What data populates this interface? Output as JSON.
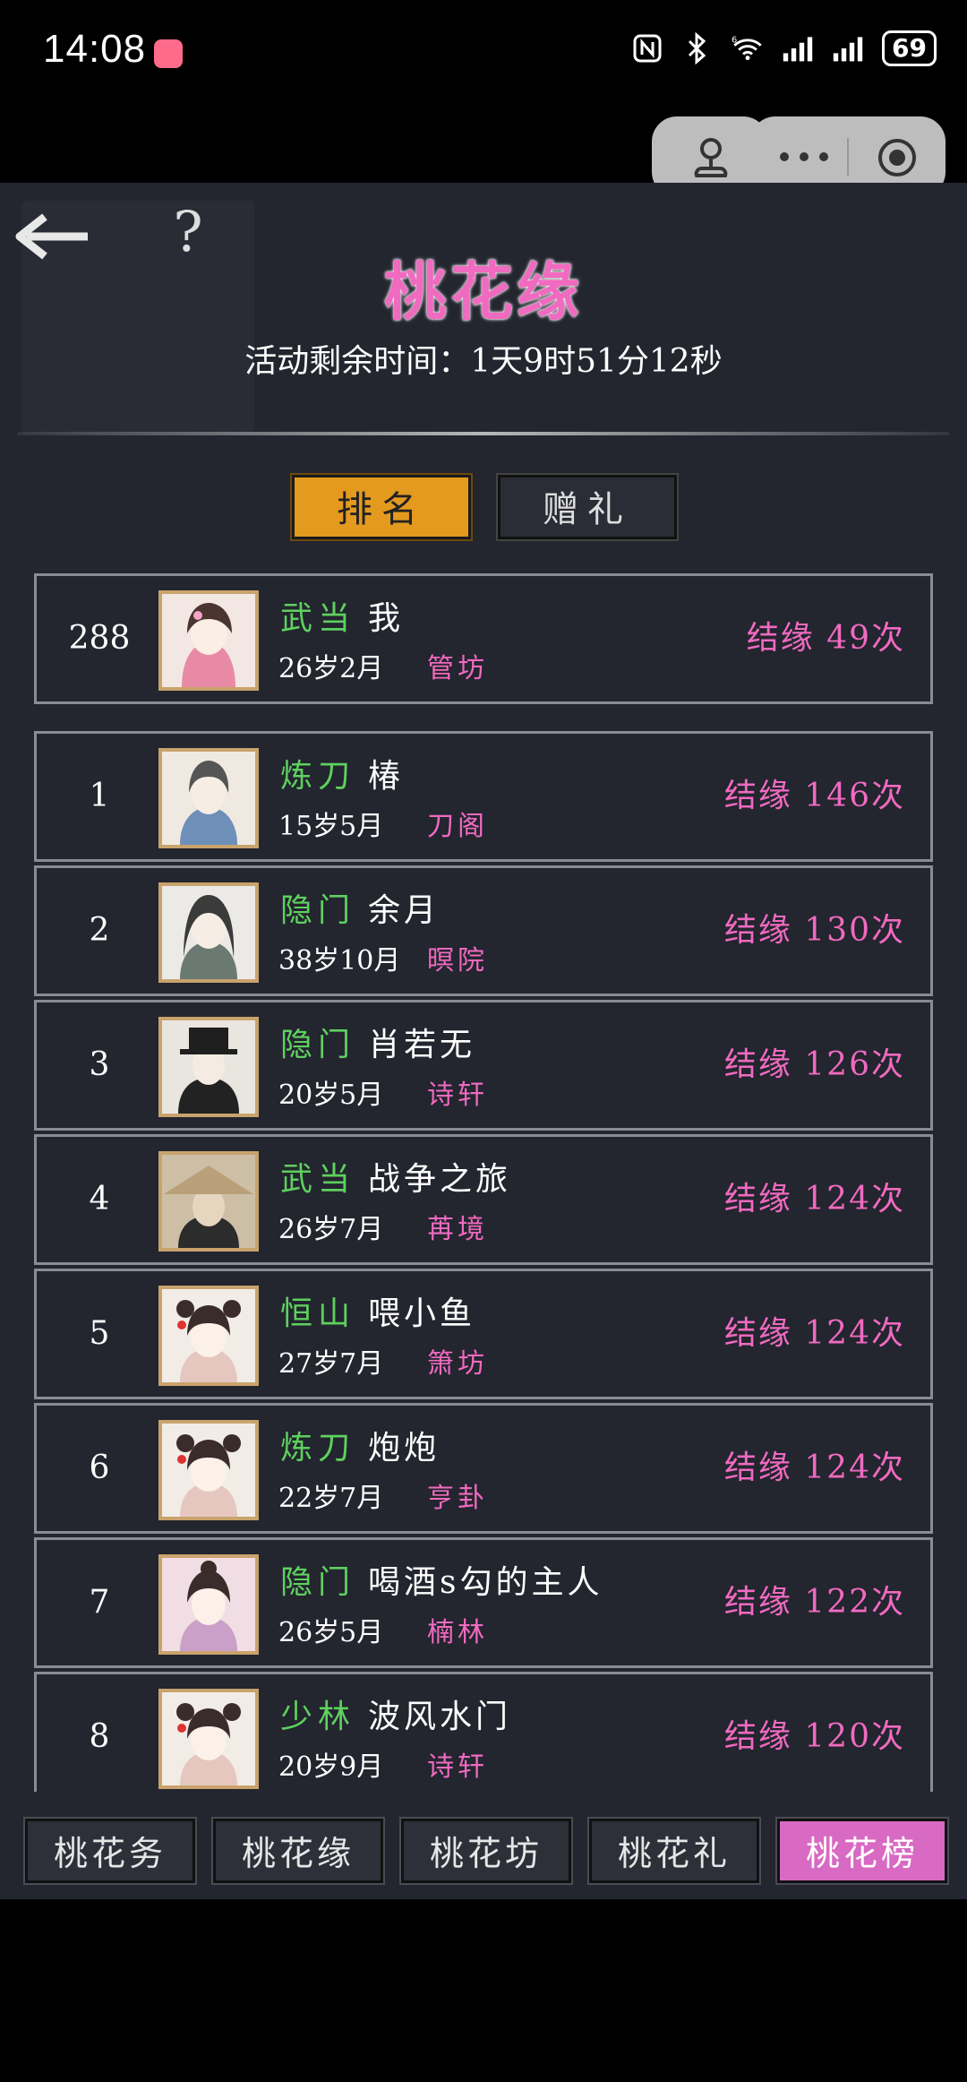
{
  "status_bar": {
    "time": "14:08",
    "battery": "69",
    "icons": [
      "nfc-icon",
      "bluetooth-icon",
      "wifi-icon",
      "signal-icon",
      "signal-icon"
    ],
    "wifi_label": "6"
  },
  "capsule": {
    "left_icon": "mini-program-icon",
    "more_icon": "more-dots-icon",
    "close_icon": "target-icon"
  },
  "header": {
    "title": "桃花缘",
    "countdown": "活动剩余时间：1天9时51分12秒",
    "back_icon": "back-arrow-icon",
    "help_label": "?"
  },
  "tabs": [
    {
      "label": "排名",
      "active": true
    },
    {
      "label": "赠礼",
      "active": false
    }
  ],
  "self_row": {
    "rank": "288",
    "sect": "武当",
    "name": "我",
    "age": "26岁2月",
    "house": "管坊",
    "bonds": "结缘 49次"
  },
  "ranking": [
    {
      "rank": "1",
      "sect": "炼刀",
      "name": "椿",
      "age": "15岁5月",
      "house": "刀阁",
      "bonds": "结缘 146次"
    },
    {
      "rank": "2",
      "sect": "隐门",
      "name": "余月",
      "age": "38岁10月",
      "house": "暝院",
      "bonds": "结缘 130次"
    },
    {
      "rank": "3",
      "sect": "隐门",
      "name": "肖若无",
      "age": "20岁5月",
      "house": "诗轩",
      "bonds": "结缘 126次"
    },
    {
      "rank": "4",
      "sect": "武当",
      "name": "战争之旅",
      "age": "26岁7月",
      "house": "苒境",
      "bonds": "结缘 124次"
    },
    {
      "rank": "5",
      "sect": "恒山",
      "name": "喂小鱼",
      "age": "27岁7月",
      "house": "箫坊",
      "bonds": "结缘 124次"
    },
    {
      "rank": "6",
      "sect": "炼刀",
      "name": "炮炮",
      "age": "22岁7月",
      "house": "亨卦",
      "bonds": "结缘 124次"
    },
    {
      "rank": "7",
      "sect": "隐门",
      "name": "喝酒s勾的主人",
      "age": "26岁5月",
      "house": "楠林",
      "bonds": "结缘 122次"
    },
    {
      "rank": "8",
      "sect": "少林",
      "name": "波风水门",
      "age": "20岁9月",
      "house": "诗轩",
      "bonds": "结缘 120次"
    }
  ],
  "bottom_nav": [
    {
      "label": "桃花务",
      "active": false
    },
    {
      "label": "桃花缘",
      "active": false
    },
    {
      "label": "桃花坊",
      "active": false
    },
    {
      "label": "桃花礼",
      "active": false
    },
    {
      "label": "桃花榜",
      "active": true
    }
  ],
  "colors": {
    "accent_pink": "#f06ac0",
    "sect_green": "#5ed05e",
    "tab_active": "#e39a1f",
    "nav_active": "#d86ac3",
    "panel_bg": "#23252f"
  }
}
